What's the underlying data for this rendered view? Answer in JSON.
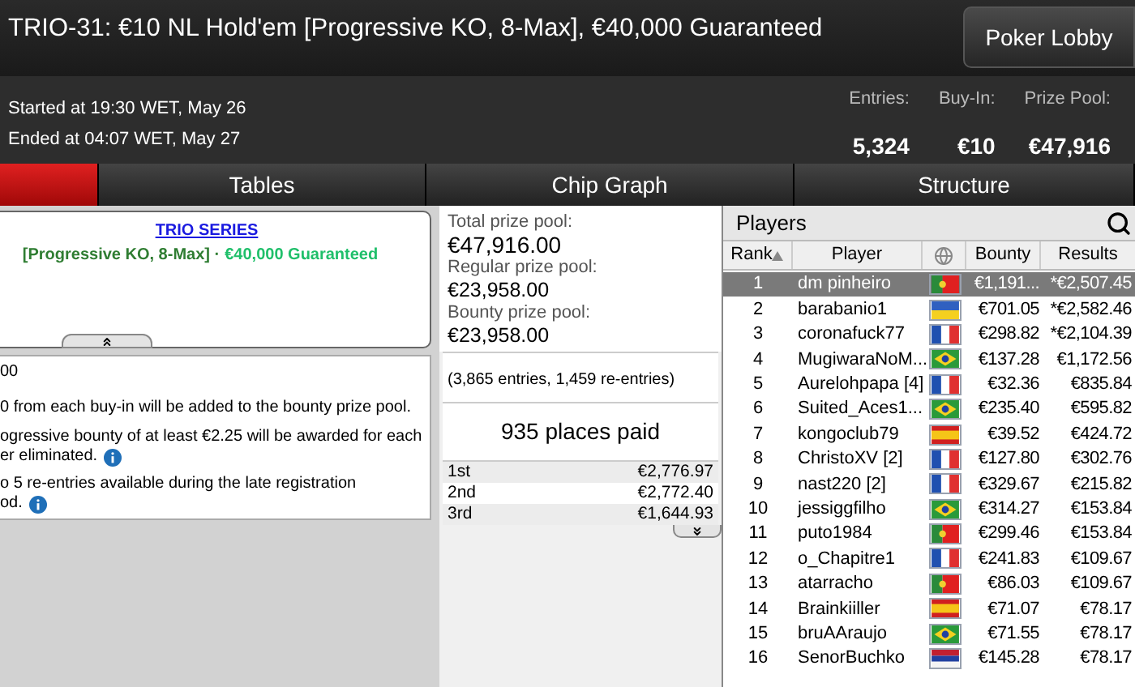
{
  "window": {
    "title": "TRIO-31: €10 NL Hold'em [Progressive KO, 8-Max], €40,000 Guaranteed"
  },
  "lobby_button": "Poker Lobby",
  "info": {
    "started": "Started at 19:30 WET, May 26",
    "ended": "Ended at 04:07 WET, May 27",
    "stats": [
      {
        "label": "Entries:",
        "value": "5,324"
      },
      {
        "label": "Buy-In:",
        "value": "€10"
      },
      {
        "label": "Prize Pool:",
        "value": "€47,916"
      }
    ]
  },
  "tabs": [
    {
      "selected": true
    },
    {
      "label": "Tables",
      "selected": false
    },
    {
      "label": "Chip Graph",
      "selected": false
    },
    {
      "label": "Structure",
      "selected": false
    }
  ],
  "banner": {
    "link": "TRIO SERIES",
    "segments": [
      {
        "text": "[Progressive KO, 8-Max] ·",
        "color": "#2f7d32"
      },
      {
        "text": "€40,000 Guaranteed",
        "color": "#1fbf6a"
      }
    ]
  },
  "description": [
    {
      "text": "00",
      "info": false
    },
    {
      "text": "0 from each buy-in will be added to the bounty prize pool.",
      "info": false
    },
    {
      "text": "ogressive bounty of at least €2.25 will be awarded for each",
      "info": false
    },
    {
      "text": "er eliminated.",
      "info": true
    },
    {
      "text": "o 5 re-entries available during the late registration",
      "info": false
    },
    {
      "text": "od.",
      "info": true
    }
  ],
  "prize_pool": {
    "items": [
      {
        "label": "Total prize pool:",
        "value": "€47,916.00"
      },
      {
        "label": "Regular prize pool:",
        "value": "€23,958.00"
      },
      {
        "label": "Bounty prize pool:",
        "value": "€23,958.00"
      }
    ],
    "entries_note": "(3,865 entries, 1,459 re-entries)",
    "places_paid": "935 places paid",
    "payouts": [
      {
        "place": "1st",
        "amount": "€2,776.97"
      },
      {
        "place": "2nd",
        "amount": "€2,772.40"
      },
      {
        "place": "3rd",
        "amount": "€1,644.93"
      }
    ]
  },
  "players": {
    "title": "Players",
    "columns": [
      "Rank",
      "Player",
      "Bounty",
      "Results"
    ],
    "rows": [
      {
        "rank": "1",
        "name": "dm pinheiro",
        "flag": {
          "kind": "pt"
        },
        "bounty": "€1,191...",
        "results": "*€2,507.45",
        "selected": true
      },
      {
        "rank": "2",
        "name": "barabanio1",
        "flag": {
          "kind": "ua"
        },
        "bounty": "€701.05",
        "results": "*€2,582.46",
        "selected": false
      },
      {
        "rank": "3",
        "name": "coronafuck77",
        "flag": {
          "kind": "fr"
        },
        "bounty": "€298.82",
        "results": "*€2,104.39",
        "selected": false
      },
      {
        "rank": "4",
        "name": "MugiwaraNoM...",
        "flag": {
          "kind": "br"
        },
        "bounty": "€137.28",
        "results": "€1,172.56",
        "selected": false
      },
      {
        "rank": "5",
        "name": "Aurelohpapa [4]",
        "flag": {
          "kind": "fr"
        },
        "bounty": "€32.36",
        "results": "€835.84",
        "selected": false
      },
      {
        "rank": "6",
        "name": "Suited_Aces1...",
        "flag": {
          "kind": "br"
        },
        "bounty": "€235.40",
        "results": "€595.82",
        "selected": false
      },
      {
        "rank": "7",
        "name": "kongoclub79",
        "flag": {
          "kind": "es"
        },
        "bounty": "€39.52",
        "results": "€424.72",
        "selected": false
      },
      {
        "rank": "8",
        "name": "ChristoXV [2]",
        "flag": {
          "kind": "fr"
        },
        "bounty": "€127.80",
        "results": "€302.76",
        "selected": false
      },
      {
        "rank": "9",
        "name": "nast220 [2]",
        "flag": {
          "kind": "fr"
        },
        "bounty": "€329.67",
        "results": "€215.82",
        "selected": false
      },
      {
        "rank": "10",
        "name": "jessiggfilho",
        "flag": {
          "kind": "br"
        },
        "bounty": "€314.27",
        "results": "€153.84",
        "selected": false
      },
      {
        "rank": "11",
        "name": "puto1984",
        "flag": {
          "kind": "pt"
        },
        "bounty": "€299.46",
        "results": "€153.84",
        "selected": false
      },
      {
        "rank": "12",
        "name": "o_Chapitre1",
        "flag": {
          "kind": "fr"
        },
        "bounty": "€241.83",
        "results": "€109.67",
        "selected": false
      },
      {
        "rank": "13",
        "name": "atarracho",
        "flag": {
          "kind": "pt"
        },
        "bounty": "€86.03",
        "results": "€109.67",
        "selected": false
      },
      {
        "rank": "14",
        "name": "Brainkiiller",
        "flag": {
          "kind": "es"
        },
        "bounty": "€71.07",
        "results": "€78.17",
        "selected": false
      },
      {
        "rank": "15",
        "name": "bruAAraujo",
        "flag": {
          "kind": "br"
        },
        "bounty": "€71.55",
        "results": "€78.17",
        "selected": false
      },
      {
        "rank": "16",
        "name": "SenorBuchko",
        "flag": {
          "kind": "rs"
        },
        "bounty": "€145.28",
        "results": "€78.17",
        "selected": false
      }
    ]
  }
}
